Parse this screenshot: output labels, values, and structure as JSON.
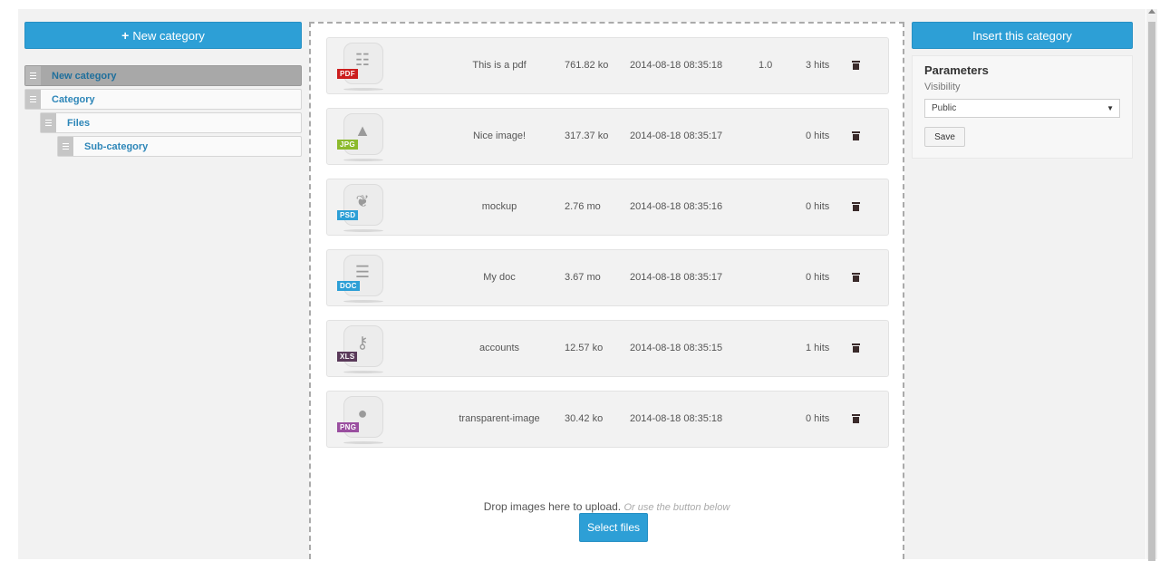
{
  "left": {
    "new_category_label": "New category",
    "tree": [
      {
        "label": "New category",
        "depth": 0,
        "active": true
      },
      {
        "label": "Category",
        "depth": 0,
        "active": false
      },
      {
        "label": "Files",
        "depth": 1,
        "active": false
      },
      {
        "label": "Sub-category",
        "depth": 2,
        "active": false
      }
    ]
  },
  "files": [
    {
      "ext": "PDF",
      "ext_color": "#cc1f1f",
      "icon": "document-icon",
      "title": "This is a pdf",
      "size": "761.82 ko",
      "date": "2014-08-18 08:35:18",
      "version": "1.0",
      "hits": "3 hits"
    },
    {
      "ext": "JPG",
      "ext_color": "#8cba2c",
      "icon": "shapes-icon",
      "title": "Nice image!",
      "size": "317.37 ko",
      "date": "2014-08-18 08:35:17",
      "version": "",
      "hits": "0 hits"
    },
    {
      "ext": "PSD",
      "ext_color": "#2d9fd6",
      "icon": "feather-icon",
      "title": "mockup",
      "size": "2.76 mo",
      "date": "2014-08-18 08:35:16",
      "version": "",
      "hits": "0 hits"
    },
    {
      "ext": "DOC",
      "ext_color": "#2d9fd6",
      "icon": "text-document-icon",
      "title": "My doc",
      "size": "3.67 mo",
      "date": "2014-08-18 08:35:17",
      "version": "",
      "hits": "0 hits"
    },
    {
      "ext": "XLS",
      "ext_color": "#5a3a5a",
      "icon": "key-icon",
      "title": "accounts",
      "size": "12.57 ko",
      "date": "2014-08-18 08:35:15",
      "version": "",
      "hits": "1 hits"
    },
    {
      "ext": "PNG",
      "ext_color": "#9a4fa0",
      "icon": "circle-image-icon",
      "title": "transparent-image",
      "size": "30.42 ko",
      "date": "2014-08-18 08:35:18",
      "version": "",
      "hits": "0 hits"
    }
  ],
  "dropzone": {
    "text": "Drop images here to upload.",
    "hint": "Or use the button below",
    "select_label": "Select files"
  },
  "right": {
    "insert_label": "Insert this category",
    "params_title": "Parameters",
    "visibility_label": "Visibility",
    "visibility_value": "Public",
    "save_label": "Save"
  }
}
